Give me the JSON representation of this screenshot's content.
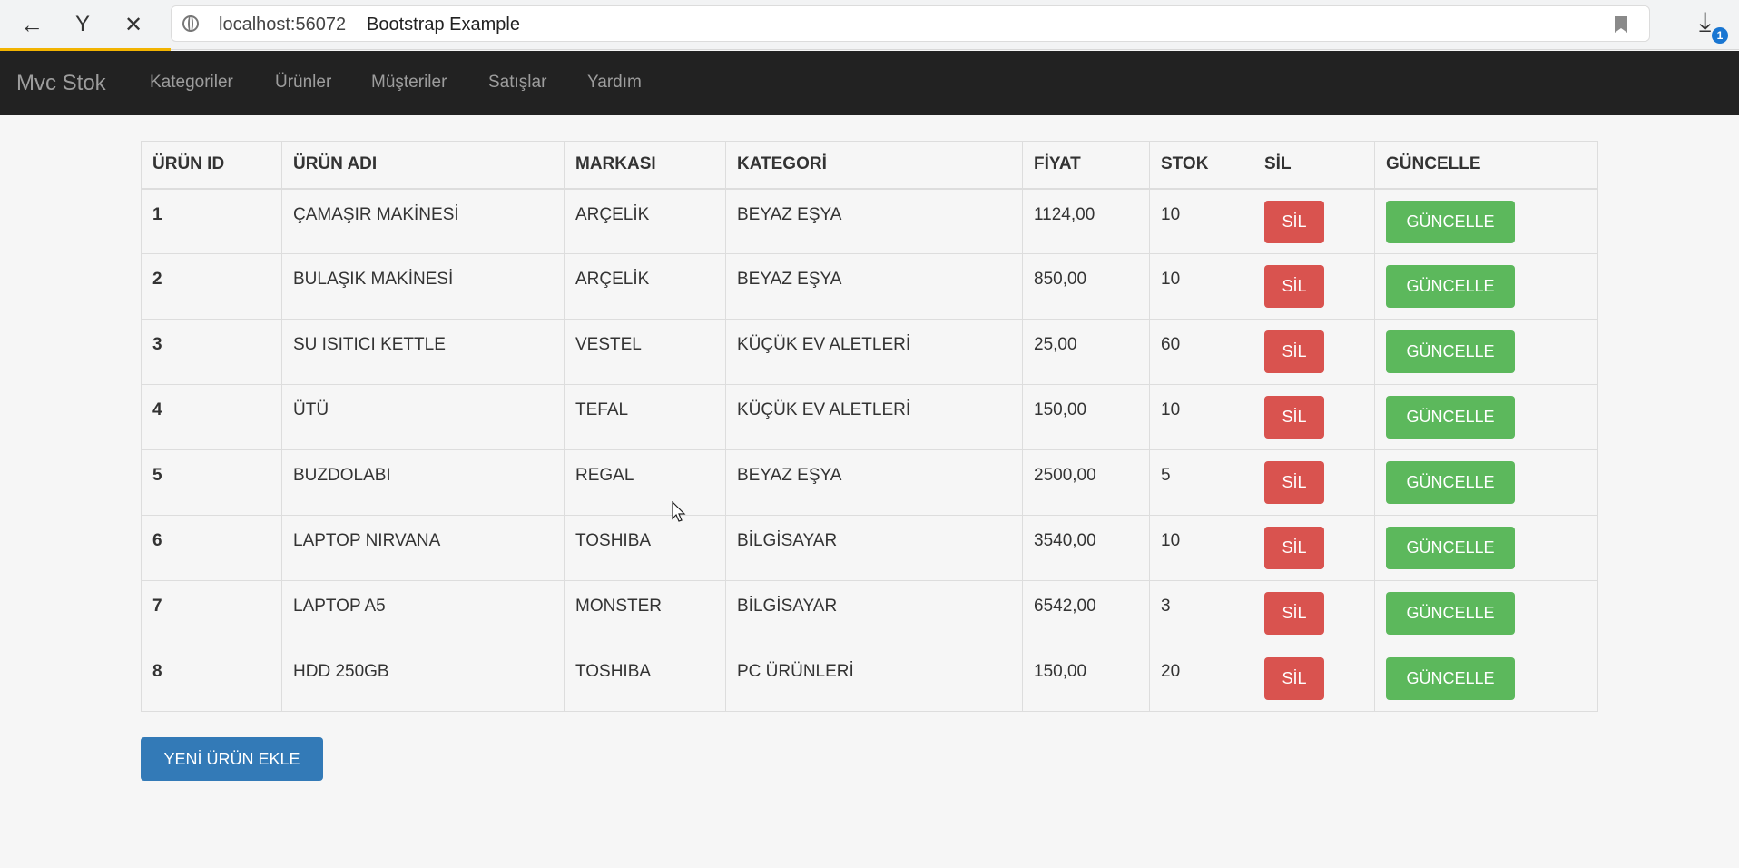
{
  "browser": {
    "url": "localhost:56072",
    "tab_title": "Bootstrap Example",
    "download_badge": "1",
    "icons": [
      "back-icon",
      "yandex-icon",
      "close-icon",
      "globe-icon",
      "bookmark-icon",
      "download-icon"
    ]
  },
  "navbar": {
    "brand": "Mvc Stok",
    "items": [
      {
        "label": "Kategoriler"
      },
      {
        "label": "Ürünler"
      },
      {
        "label": "Müşteriler"
      },
      {
        "label": "Satışlar"
      },
      {
        "label": "Yardım"
      }
    ]
  },
  "table": {
    "headers": [
      "ÜRÜN ID",
      "ÜRÜN ADI",
      "MARKASI",
      "KATEGORİ",
      "FİYAT",
      "STOK",
      "SİL",
      "GÜNCELLE"
    ],
    "rows": [
      {
        "id": "1",
        "name": "ÇAMAŞIR MAKİNESİ",
        "brand": "ARÇELİK",
        "category": "BEYAZ EŞYA",
        "price": "1124,00",
        "stock": "10",
        "delete": "SİL",
        "update": "GÜNCELLE"
      },
      {
        "id": "2",
        "name": "BULAŞIK MAKİNESİ",
        "brand": "ARÇELİK",
        "category": "BEYAZ EŞYA",
        "price": "850,00",
        "stock": "10",
        "delete": "SİL",
        "update": "GÜNCELLE"
      },
      {
        "id": "3",
        "name": "SU ISITICI KETTLE",
        "brand": "VESTEL",
        "category": "KÜÇÜK EV ALETLERİ",
        "price": "25,00",
        "stock": "60",
        "delete": "SİL",
        "update": "GÜNCELLE"
      },
      {
        "id": "4",
        "name": "ÜTÜ",
        "brand": "TEFAL",
        "category": "KÜÇÜK EV ALETLERİ",
        "price": "150,00",
        "stock": "10",
        "delete": "SİL",
        "update": "GÜNCELLE"
      },
      {
        "id": "5",
        "name": "BUZDOLABI",
        "brand": "REGAL",
        "category": "BEYAZ EŞYA",
        "price": "2500,00",
        "stock": "5",
        "delete": "SİL",
        "update": "GÜNCELLE"
      },
      {
        "id": "6",
        "name": "LAPTOP NIRVANA",
        "brand": "TOSHIBA",
        "category": "BİLGİSAYAR",
        "price": "3540,00",
        "stock": "10",
        "delete": "SİL",
        "update": "GÜNCELLE"
      },
      {
        "id": "7",
        "name": "LAPTOP A5",
        "brand": "MONSTER",
        "category": "BİLGİSAYAR",
        "price": "6542,00",
        "stock": "3",
        "delete": "SİL",
        "update": "GÜNCELLE"
      },
      {
        "id": "8",
        "name": "HDD 250GB",
        "brand": "TOSHIBA",
        "category": "PC ÜRÜNLERİ",
        "price": "150,00",
        "stock": "20",
        "delete": "SİL",
        "update": "GÜNCELLE"
      }
    ]
  },
  "actions": {
    "new_product": "YENİ ÜRÜN EKLE"
  },
  "colors": {
    "navbar_bg": "#222222",
    "danger": "#d9534f",
    "success": "#5cb85c",
    "primary": "#337ab7"
  }
}
